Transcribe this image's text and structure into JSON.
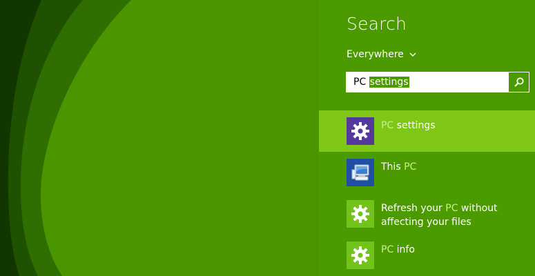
{
  "search_pane": {
    "title": "Search",
    "scope": "Everywhere",
    "query_typed": "PC",
    "query_autocomplete": "settings",
    "search_button_icon": "magnifier-icon"
  },
  "results": [
    {
      "pre": "",
      "match": "PC",
      "post": " settings",
      "icon": "gear-icon",
      "tile_color": "#553a9e",
      "selected": true
    },
    {
      "pre": "This ",
      "match": "PC",
      "post": "",
      "icon": "computer-icon",
      "tile_color": "#1f4fa3",
      "selected": false
    },
    {
      "pre": "Refresh your ",
      "match": "PC",
      "post": " without affecting your files",
      "icon": "gear-icon",
      "tile_color": "#72c31a",
      "selected": false
    },
    {
      "pre": "",
      "match": "PC",
      "post": " info",
      "icon": "gear-icon",
      "tile_color": "#72c31a",
      "selected": false
    }
  ],
  "colors": {
    "pane_bg": "#4b9a00",
    "selected_bg": "#7ec716",
    "desktop_light": "#4f9e00",
    "desktop_dark": "#1a4a00"
  }
}
